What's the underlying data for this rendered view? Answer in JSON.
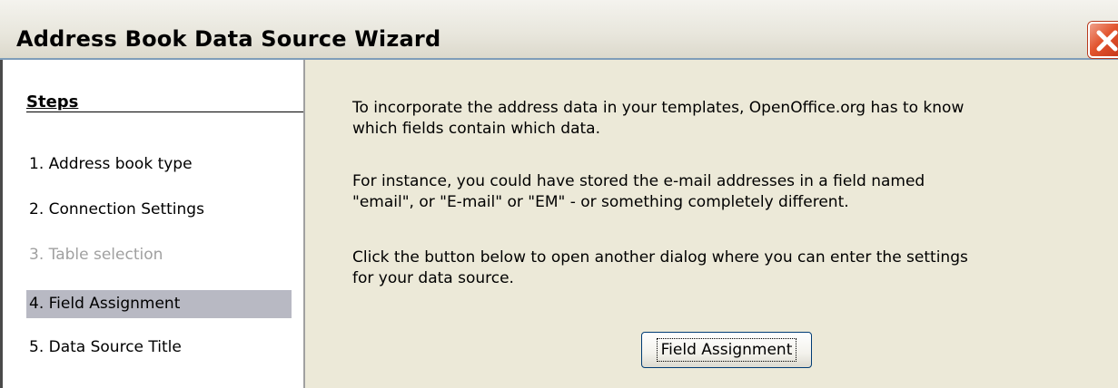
{
  "window": {
    "title": "Address Book Data Source Wizard",
    "close_icon": "close-icon"
  },
  "steps": {
    "header": "Steps",
    "items": [
      {
        "label": "1. Address book type",
        "state": "normal"
      },
      {
        "label": "2. Connection Settings",
        "state": "normal"
      },
      {
        "label": "3. Table selection",
        "state": "disabled"
      },
      {
        "label": "4. Field Assignment",
        "state": "active"
      },
      {
        "label": "5. Data Source Title",
        "state": "normal"
      }
    ]
  },
  "content": {
    "para1_line1": "To incorporate the address data in your templates, OpenOffice.org has to know",
    "para1_line2": "which fields contain which data.",
    "para2_line1": "For instance, you could have stored the e-mail addresses in a field named",
    "para2_line2": "\"email\", or \"E-mail\" or \"EM\" - or something completely different.",
    "para3_line1": "Click the button below to open another dialog where you can enter the settings",
    "para3_line2": "for your data source.",
    "button_label": "Field Assignment"
  },
  "colors": {
    "active_step_bg": "#b8b9c3",
    "disabled_step_text": "#a0a0a0",
    "dialog_bg": "#ece9d8",
    "close_button": "#e2542e"
  }
}
